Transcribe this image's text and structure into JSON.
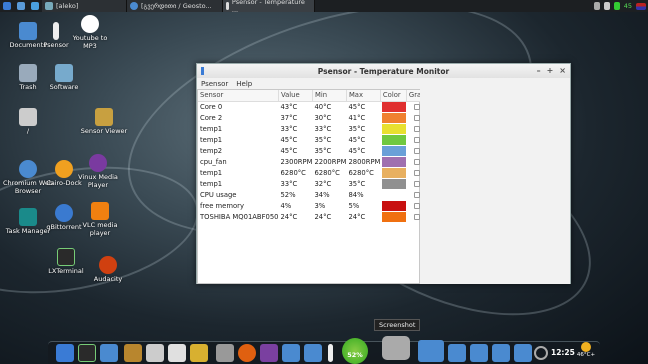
{
  "top_panel": {
    "tasks": [
      {
        "label": "[aleko]"
      },
      {
        "label": "[გვერდითი / Geosto..."
      },
      {
        "label": "Psensor - Temperature ..."
      }
    ],
    "battery_percent": "45"
  },
  "desktop_icons": [
    {
      "label": "Documents"
    },
    {
      "label": "Psensor"
    },
    {
      "label": "Youtube to MP3"
    },
    {
      "label": "Trash"
    },
    {
      "label": "Software"
    },
    {
      "label": "/"
    },
    {
      "label": "Sensor Viewer"
    },
    {
      "label": "Chromium Web Browser"
    },
    {
      "label": "Cairo-Dock"
    },
    {
      "label": "Vinux Media Player"
    },
    {
      "label": "Task Manager"
    },
    {
      "label": "qBittorrent"
    },
    {
      "label": "VLC media player"
    },
    {
      "label": "LXTerminal"
    },
    {
      "label": "Audacity"
    }
  ],
  "window": {
    "title": "Psensor - Temperature Monitor",
    "menu": [
      "Psensor",
      "Help"
    ],
    "columns": [
      "Sensor",
      "Value",
      "Min",
      "Max",
      "Color",
      "Graph"
    ],
    "rows": [
      {
        "sensor": "Core 0",
        "value": "43°C",
        "min": "40°C",
        "max": "45°C",
        "color": "#e03030"
      },
      {
        "sensor": "Core 2",
        "value": "37°C",
        "min": "30°C",
        "max": "41°C",
        "color": "#f08030"
      },
      {
        "sensor": "temp1",
        "value": "33°C",
        "min": "33°C",
        "max": "35°C",
        "color": "#e8e030"
      },
      {
        "sensor": "temp1",
        "value": "45°C",
        "min": "35°C",
        "max": "45°C",
        "color": "#70c840"
      },
      {
        "sensor": "temp2",
        "value": "45°C",
        "min": "35°C",
        "max": "45°C",
        "color": "#6aa0d8"
      },
      {
        "sensor": "cpu_fan",
        "value": "2300RPM",
        "min": "2200RPM",
        "max": "2800RPM",
        "color": "#a070b0"
      },
      {
        "sensor": "temp1",
        "value": "6280°C",
        "min": "6280°C",
        "max": "6280°C",
        "color": "#e8b060"
      },
      {
        "sensor": "temp1",
        "value": "33°C",
        "min": "32°C",
        "max": "35°C",
        "color": "#909090"
      },
      {
        "sensor": "CPU usage",
        "value": "52%",
        "min": "34%",
        "max": "84%",
        "color": ""
      },
      {
        "sensor": "free memory",
        "value": "4%",
        "min": "3%",
        "max": "5%",
        "color": "#c81010"
      },
      {
        "sensor": "TOSHIBA MQ01ABF050",
        "value": "24°C",
        "min": "24°C",
        "max": "24°C",
        "color": "#f07010"
      }
    ]
  },
  "tooltip": "Screenshot",
  "dock": {
    "cpu_badge": "52%",
    "clock": "12:25",
    "weather": "46°C+"
  }
}
